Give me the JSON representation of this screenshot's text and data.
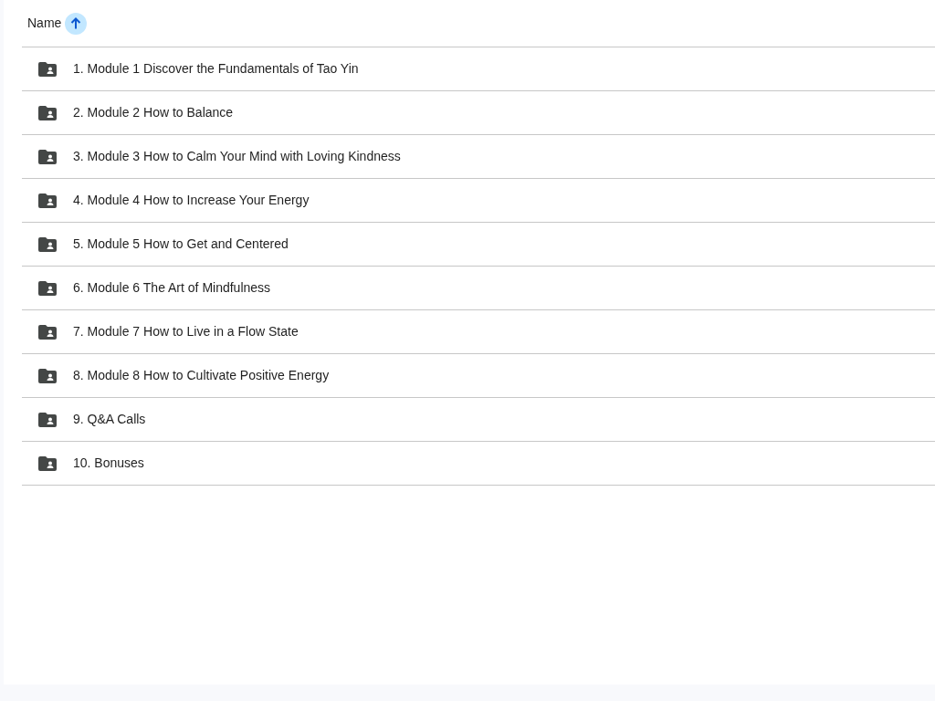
{
  "header": {
    "column": "Name",
    "sort_ascending": true
  },
  "folders": [
    {
      "name": "1. Module 1 Discover the Fundamentals of Tao Yin"
    },
    {
      "name": "2. Module 2 How to Balance"
    },
    {
      "name": "3. Module 3 How to Calm Your Mind with Loving Kindness"
    },
    {
      "name": "4. Module 4 How to Increase Your Energy"
    },
    {
      "name": "5. Module 5 How to Get and Centered"
    },
    {
      "name": "6. Module 6 The Art of Mindfulness"
    },
    {
      "name": "7. Module 7 How to Live in a Flow State"
    },
    {
      "name": "8. Module 8 How to Cultivate Positive Energy"
    },
    {
      "name": "9. Q&A Calls"
    },
    {
      "name": "10. Bonuses"
    }
  ]
}
